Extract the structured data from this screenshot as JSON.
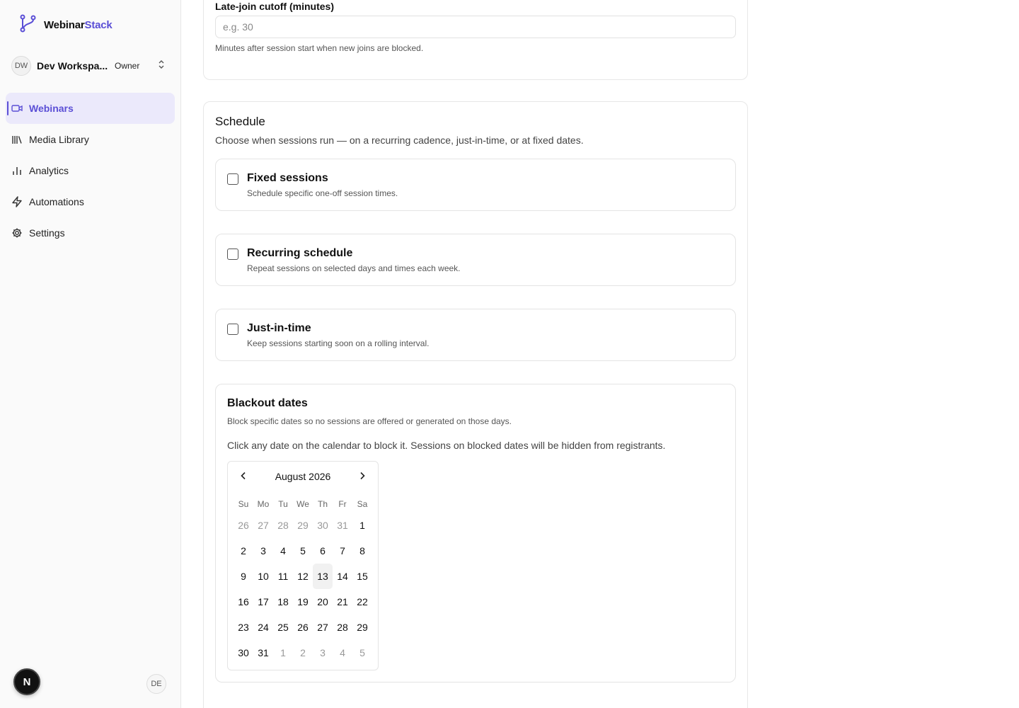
{
  "brand": {
    "name": "Webinar",
    "accent": "Stack",
    "accent_color": "#5b4fd6"
  },
  "workspace": {
    "initials": "DW",
    "name": "Dev Workspa...",
    "role": "Owner"
  },
  "nav": [
    {
      "label": "Webinars",
      "icon": "video-icon",
      "active": true
    },
    {
      "label": "Media Library",
      "icon": "library-icon",
      "active": false
    },
    {
      "label": "Analytics",
      "icon": "bar-chart-icon",
      "active": false
    },
    {
      "label": "Automations",
      "icon": "zap-icon",
      "active": false
    },
    {
      "label": "Settings",
      "icon": "gear-icon",
      "active": false
    }
  ],
  "footer": {
    "next_badge": "N",
    "language": "DE"
  },
  "late_join": {
    "label": "Late-join cutoff (minutes)",
    "placeholder": "e.g. 30",
    "help": "Minutes after session start when new joins are blocked."
  },
  "schedule": {
    "title": "Schedule",
    "description": "Choose when sessions run — on a recurring cadence, just-in-time, or at fixed dates.",
    "options": [
      {
        "title": "Fixed sessions",
        "description": "Schedule specific one-off session times.",
        "checked": false
      },
      {
        "title": "Recurring schedule",
        "description": "Repeat sessions on selected days and times each week.",
        "checked": false
      },
      {
        "title": "Just-in-time",
        "description": "Keep sessions starting soon on a rolling interval.",
        "checked": false
      }
    ]
  },
  "blackout": {
    "title": "Blackout dates",
    "description": "Block specific dates so no sessions are offered or generated on those days.",
    "hint": "Click any date on the calendar to block it. Sessions on blocked dates will be hidden from registrants.",
    "calendar": {
      "month": "August 2026",
      "weekdays": [
        "Su",
        "Mo",
        "Tu",
        "We",
        "Th",
        "Fr",
        "Sa"
      ],
      "today": 13,
      "weeks": [
        [
          {
            "d": "26",
            "o": true
          },
          {
            "d": "27",
            "o": true
          },
          {
            "d": "28",
            "o": true
          },
          {
            "d": "29",
            "o": true
          },
          {
            "d": "30",
            "o": true
          },
          {
            "d": "31",
            "o": true
          },
          {
            "d": "1",
            "o": false
          }
        ],
        [
          {
            "d": "2",
            "o": false
          },
          {
            "d": "3",
            "o": false
          },
          {
            "d": "4",
            "o": false
          },
          {
            "d": "5",
            "o": false
          },
          {
            "d": "6",
            "o": false
          },
          {
            "d": "7",
            "o": false
          },
          {
            "d": "8",
            "o": false
          }
        ],
        [
          {
            "d": "9",
            "o": false
          },
          {
            "d": "10",
            "o": false
          },
          {
            "d": "11",
            "o": false
          },
          {
            "d": "12",
            "o": false
          },
          {
            "d": "13",
            "o": false
          },
          {
            "d": "14",
            "o": false
          },
          {
            "d": "15",
            "o": false
          }
        ],
        [
          {
            "d": "16",
            "o": false
          },
          {
            "d": "17",
            "o": false
          },
          {
            "d": "18",
            "o": false
          },
          {
            "d": "19",
            "o": false
          },
          {
            "d": "20",
            "o": false
          },
          {
            "d": "21",
            "o": false
          },
          {
            "d": "22",
            "o": false
          }
        ],
        [
          {
            "d": "23",
            "o": false
          },
          {
            "d": "24",
            "o": false
          },
          {
            "d": "25",
            "o": false
          },
          {
            "d": "26",
            "o": false
          },
          {
            "d": "27",
            "o": false
          },
          {
            "d": "28",
            "o": false
          },
          {
            "d": "29",
            "o": false
          }
        ],
        [
          {
            "d": "30",
            "o": false
          },
          {
            "d": "31",
            "o": false
          },
          {
            "d": "1",
            "o": true
          },
          {
            "d": "2",
            "o": true
          },
          {
            "d": "3",
            "o": true
          },
          {
            "d": "4",
            "o": true
          },
          {
            "d": "5",
            "o": true
          }
        ]
      ]
    }
  }
}
